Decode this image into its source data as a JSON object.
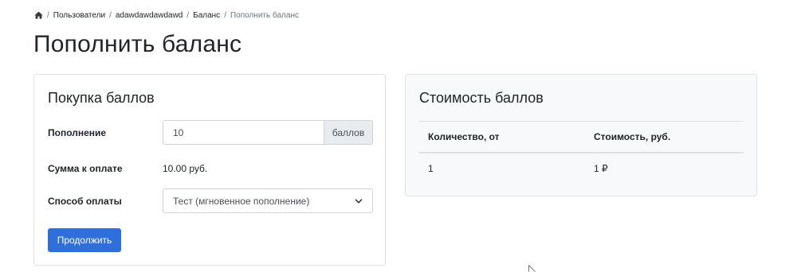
{
  "breadcrumb": {
    "home_icon": "home-icon",
    "items": [
      "Пользователи",
      "adawdawdawdawd",
      "Баланс",
      "Пополнить баланс"
    ],
    "separator": "/"
  },
  "page_title": "Пополнить баланс",
  "purchase_card": {
    "title": "Покупка баллов",
    "topup_label": "Пополнение",
    "topup_value": "10",
    "topup_unit": "баллов",
    "sum_label": "Сумма к оплате",
    "sum_value": "10.00 руб.",
    "payment_label": "Способ оплаты",
    "payment_selected": "Тест (мгновенное пополнение)",
    "continue_button": "Продолжить"
  },
  "cost_card": {
    "title": "Стоимость баллов",
    "columns": [
      "Количество, от",
      "Стоимость, руб."
    ],
    "rows": [
      [
        "1",
        "1 ₽"
      ]
    ]
  },
  "colors": {
    "primary": "#2f6fdc",
    "card_bg_alt": "#f8f9fa",
    "border": "#dfe2e6"
  }
}
